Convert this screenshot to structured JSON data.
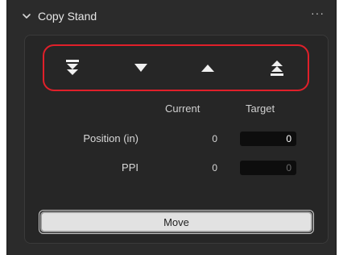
{
  "panel": {
    "title": "Copy Stand",
    "more_glyph": "···",
    "collapse_icon": "chevron-down-icon"
  },
  "jog": {
    "highlight_color": "#e0202a",
    "buttons": [
      {
        "icon": "double-down-icon"
      },
      {
        "icon": "down-icon"
      },
      {
        "icon": "up-icon"
      },
      {
        "icon": "double-up-icon"
      }
    ]
  },
  "columns": {
    "current": "Current",
    "target": "Target"
  },
  "rows": [
    {
      "label": "Position (in)",
      "current": "0",
      "target": "0"
    },
    {
      "label": "PPI",
      "current": "0",
      "target": "0"
    }
  ],
  "move_button": {
    "label": "Move"
  }
}
